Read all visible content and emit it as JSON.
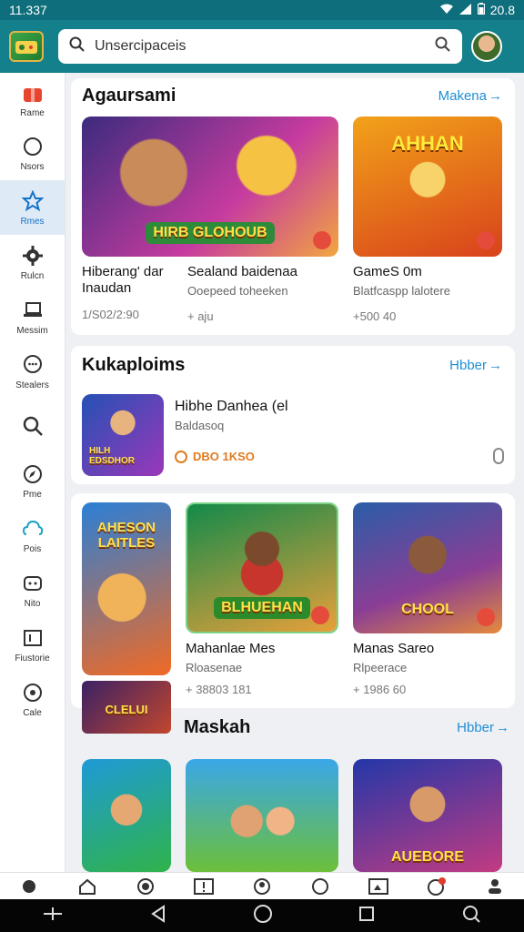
{
  "status": {
    "time": "11.337",
    "battery": "20.8"
  },
  "search": {
    "placeholder": "Unsercipaceis"
  },
  "sidebar": {
    "items": [
      {
        "label": "Rame",
        "icon": "gift-icon"
      },
      {
        "label": "Nsors",
        "icon": "circle-icon"
      },
      {
        "label": "Rmes",
        "icon": "star-icon"
      },
      {
        "label": "Rulcn",
        "icon": "gear-icon"
      },
      {
        "label": "Messim",
        "icon": "laptop-icon"
      },
      {
        "label": "Stealers",
        "icon": "chat-icon"
      },
      {
        "label": "",
        "icon": "search-icon"
      },
      {
        "label": "Pme",
        "icon": "compass-icon"
      },
      {
        "label": "Pois",
        "icon": "cloud-icon"
      },
      {
        "label": "Nito",
        "icon": "gamepad-icon"
      },
      {
        "label": "Fiustorie",
        "icon": "flag-icon"
      },
      {
        "label": "Cale",
        "icon": "target-icon"
      }
    ]
  },
  "section1": {
    "title": "Agaursami",
    "link": "Makena",
    "games": [
      {
        "name": "Hiberang' dar Inaudan",
        "sub": "",
        "meta": "1/S02/2:90",
        "badge": "HIRB GLOHOUB",
        "color1": "#3b2b7e",
        "color2": "#c63b9f"
      },
      {
        "name": "Sealand baidenaa",
        "sub": "Ooepeed toheeken",
        "meta": "+ aju",
        "badge": "",
        "color1": "",
        "color2": ""
      },
      {
        "name": "GameS 0m",
        "sub": "Blatfcaspp lalotere",
        "meta": "+500 40",
        "badge": "AHHAN",
        "color1": "#f2a21a",
        "color2": "#d8421b"
      }
    ]
  },
  "section2": {
    "title": "Kukaploims",
    "link": "Hbber",
    "item": {
      "name": "Hibhe Danhea (el",
      "sub": "Baldasoq",
      "meta": "DBO 1KSO",
      "badge": "HILH EDSDHOR"
    }
  },
  "section3": {
    "games": [
      {
        "name": "",
        "sub": "",
        "meta": "",
        "badge": "AHESON LAITLES",
        "color1": "#2b7fd6",
        "color2": "#f06a25"
      },
      {
        "name": "Mahanlae Mes",
        "sub": "Rloasenae",
        "meta": "+ 38803 181",
        "badge": "BLHUEHAN",
        "color1": "#138a4a",
        "color2": "#e7a03a"
      },
      {
        "name": "Manas Sareo",
        "sub": "Rlpeerace",
        "meta": "+ 1986 60",
        "badge": "CHOOL",
        "color1": "#2a5da8",
        "color2": "#8a3e95"
      }
    ]
  },
  "section4": {
    "title": "Maskah",
    "link": "Hbber",
    "games": [
      {
        "badge": "",
        "color1": "#1f9ad6",
        "color2": "#2fb34a"
      },
      {
        "badge": "",
        "color1": "#3aa7e8",
        "color2": "#6cbf3a"
      },
      {
        "badge": "AUEBORE",
        "color1": "#2337a8",
        "color2": "#c23b82"
      }
    ]
  },
  "small_thumb": {
    "badge": "CLELUI"
  }
}
